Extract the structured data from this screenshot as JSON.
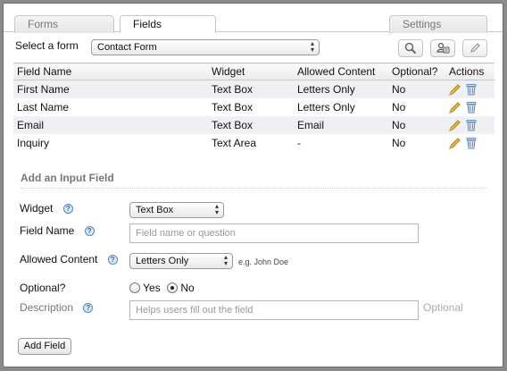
{
  "tabs": [
    {
      "label": "Forms",
      "active": false
    },
    {
      "label": "Fields",
      "active": true
    },
    {
      "label": "Settings",
      "active": false
    }
  ],
  "form_select": {
    "label": "Select a form",
    "value": "Contact Form"
  },
  "toolbar": {
    "icons": [
      "search-icon",
      "contact-card-icon",
      "pencil-icon"
    ]
  },
  "table": {
    "headers": [
      "Field Name",
      "Widget",
      "Allowed Content",
      "Optional?",
      "Actions"
    ],
    "rows": [
      [
        "First Name",
        "Text Box",
        "Letters Only",
        "No"
      ],
      [
        "Last Name",
        "Text Box",
        "Letters Only",
        "No"
      ],
      [
        "Email",
        "Text Box",
        "Email",
        "No"
      ],
      [
        "Inquiry",
        "Text Area",
        "-",
        "No"
      ]
    ],
    "row_icons": [
      "edit-pencil-icon",
      "trash-icon"
    ]
  },
  "add_field": {
    "title": "Add an Input Field",
    "widget_label": "Widget",
    "widget_value": "Text Box",
    "field_name_label": "Field Name",
    "field_name_placeholder": "Field name or question",
    "allowed_label": "Allowed Content",
    "allowed_value": "Letters Only",
    "allowed_hint": "e.g. John Doe",
    "optional_label": "Optional?",
    "optional_yes": "Yes",
    "optional_no": "No",
    "description_label": "Description",
    "description_placeholder": "Helps users fill out the field",
    "description_optional": "Optional",
    "submit_label": "Add Field",
    "help_glyph": "?"
  },
  "colors": {
    "help_blue": "#4d86c4",
    "row_tint": "#eef0f4"
  }
}
